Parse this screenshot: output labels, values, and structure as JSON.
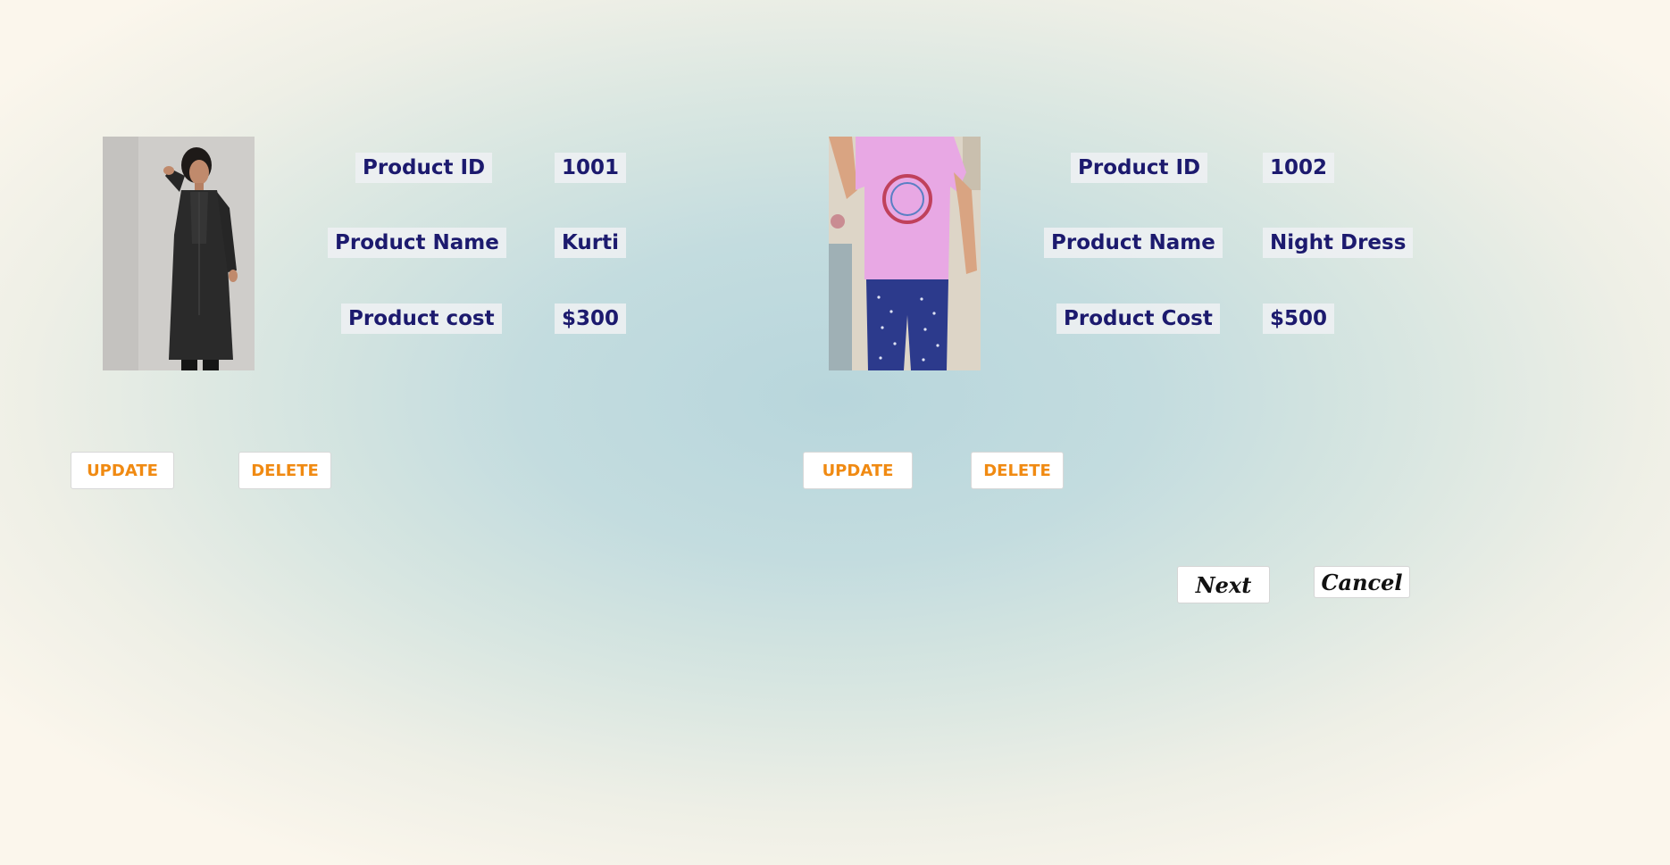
{
  "products": [
    {
      "image_alt": "Kurti",
      "id_label": "Product ID",
      "id_value": "1001",
      "name_label": "Product Name",
      "name_value": "Kurti",
      "cost_label": "Product cost",
      "cost_value": "$300",
      "update_label": "UPDATE",
      "delete_label": "DELETE"
    },
    {
      "image_alt": "Night Dress",
      "id_label": "Product ID",
      "id_value": "1002",
      "name_label": "Product Name",
      "name_value": "Night Dress",
      "cost_label": "Product Cost",
      "cost_value": "$500",
      "update_label": "UPDATE",
      "delete_label": "DELETE"
    }
  ],
  "navigation": {
    "next_label": "Next",
    "cancel_label": "Cancel"
  },
  "colors": {
    "label_text": "#1c1a6e",
    "action_text": "#f08a12",
    "chip_background": "#eef0f2"
  }
}
